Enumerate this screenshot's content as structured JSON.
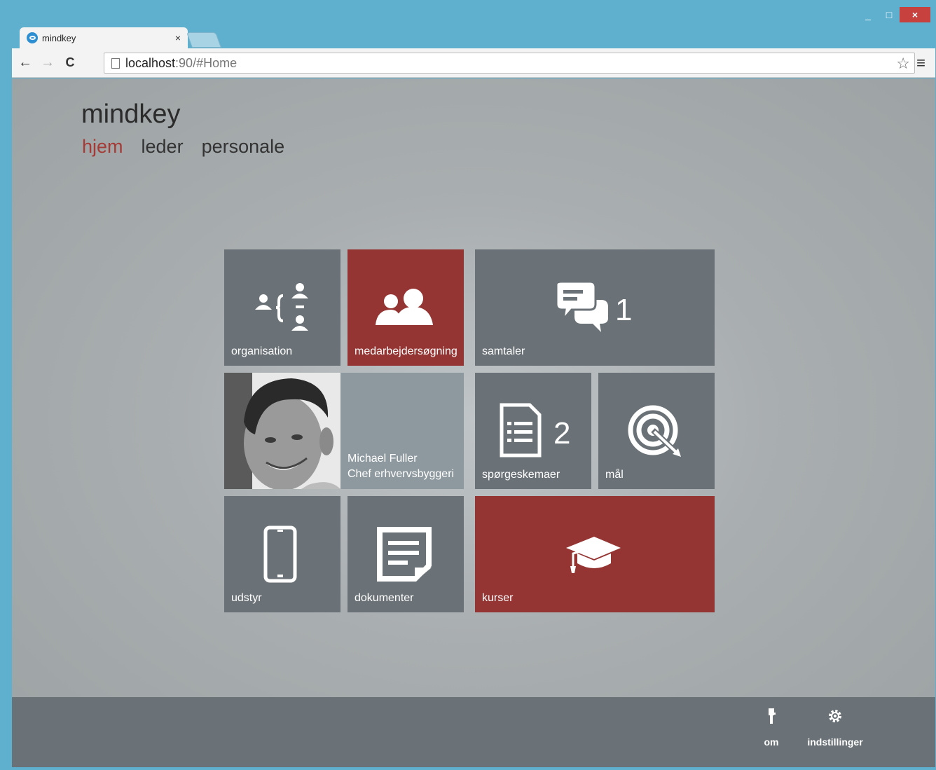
{
  "browser": {
    "tab_title": "mindkey",
    "tab_close": "×",
    "url_host": "localhost",
    "url_rest": ":90/#Home",
    "back_icon": "←",
    "forward_icon": "→",
    "reload_icon": "C",
    "star_icon": "☆",
    "menu_icon": "≡",
    "minimize": "_",
    "maximize": "□",
    "close": "×"
  },
  "app": {
    "brand": "mindkey",
    "nav": [
      {
        "label": "hjem",
        "active": true
      },
      {
        "label": "leder",
        "active": false
      },
      {
        "label": "personale",
        "active": false
      }
    ]
  },
  "tiles": {
    "organisation": {
      "label": "organisation",
      "icon": "org-chart-icon"
    },
    "survey": {
      "label": "medarbejdersøgning",
      "icon": "people-icon"
    },
    "talks": {
      "label": "samtaler",
      "count": "1",
      "icon": "chat-bubbles-icon"
    },
    "profile": {
      "name": "Michael Fuller",
      "title": "Chef erhvervsbyggeri"
    },
    "questionnaires": {
      "label": "spørgeskemaer",
      "count": "2",
      "icon": "document-list-icon"
    },
    "goals": {
      "label": "mål",
      "icon": "target-icon"
    },
    "equipment": {
      "label": "udstyr",
      "icon": "phone-icon"
    },
    "documents": {
      "label": "dokumenter",
      "icon": "note-icon"
    },
    "courses": {
      "label": "kurser",
      "icon": "graduation-cap-icon"
    }
  },
  "appbar": {
    "about": {
      "label": "om",
      "icon": "info-icon"
    },
    "settings": {
      "label": "indstillinger",
      "icon": "gear-icon"
    }
  },
  "colors": {
    "accent": "#953533",
    "tile": "#6b7277",
    "appbar": "#6a7277"
  }
}
